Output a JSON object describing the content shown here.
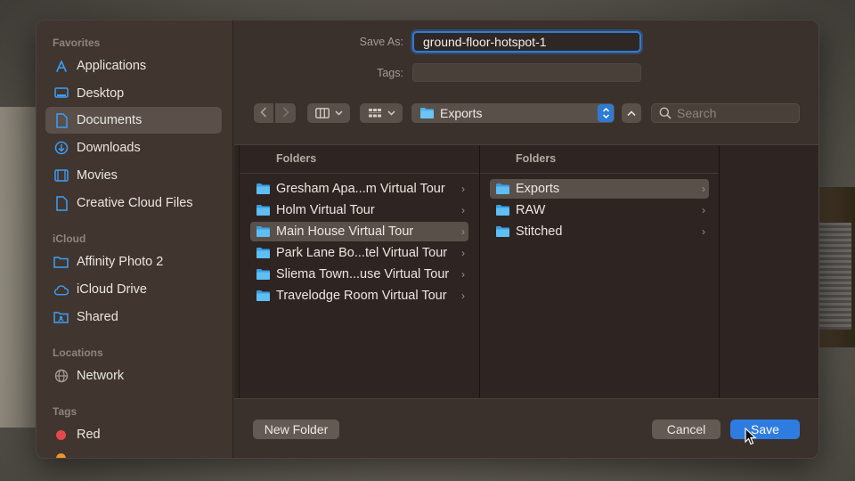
{
  "sidebar": {
    "sections": {
      "favorites": "Favorites",
      "icloud": "iCloud",
      "locations": "Locations",
      "tags": "Tags"
    },
    "favorites": [
      {
        "label": "Applications",
        "icon": "applications-icon"
      },
      {
        "label": "Desktop",
        "icon": "desktop-icon"
      },
      {
        "label": "Documents",
        "icon": "document-icon",
        "selected": true
      },
      {
        "label": "Downloads",
        "icon": "downloads-icon"
      },
      {
        "label": "Movies",
        "icon": "movies-icon"
      },
      {
        "label": "Creative Cloud Files",
        "icon": "file-icon"
      }
    ],
    "icloud": [
      {
        "label": "Affinity Photo 2",
        "icon": "folder-icon"
      },
      {
        "label": "iCloud Drive",
        "icon": "cloud-icon"
      },
      {
        "label": "Shared",
        "icon": "shared-folder-icon"
      }
    ],
    "locations": [
      {
        "label": "Network",
        "icon": "globe-icon"
      }
    ],
    "tags": [
      {
        "label": "Red",
        "color": "#e5484d"
      }
    ]
  },
  "save_as": {
    "label": "Save As:",
    "value": "ground-floor-hotspot-1"
  },
  "tags_field": {
    "label": "Tags:",
    "value": ""
  },
  "toolbar": {
    "current_folder": "Exports",
    "search_placeholder": "Search"
  },
  "browser": {
    "column1": {
      "header": "Folders",
      "items": [
        "Gresham Apa...m Virtual Tour",
        "Holm Virtual Tour",
        "Main House Virtual Tour",
        "Park Lane Bo...tel Virtual Tour",
        "Sliema Town...use Virtual Tour",
        "Travelodge Room Virtual Tour"
      ],
      "selected_index": 2
    },
    "column2": {
      "header": "Folders",
      "items": [
        "Exports",
        "RAW",
        "Stitched"
      ],
      "selected_index": 0
    }
  },
  "buttons": {
    "new_folder": "New Folder",
    "cancel": "Cancel",
    "save": "Save"
  },
  "colors": {
    "accent": "#2e7ce0",
    "folder": "#4bb3f0",
    "sidebar_icon": "#3d9df5"
  }
}
